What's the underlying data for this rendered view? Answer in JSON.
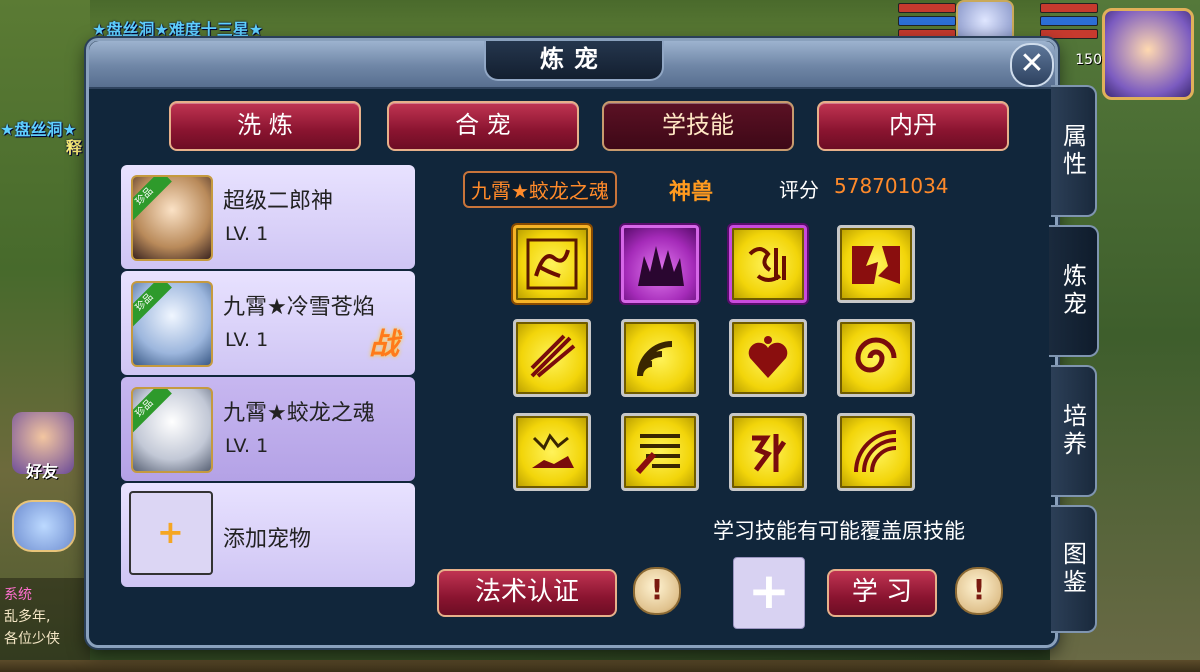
{
  "hud": {
    "banner_top": "★盘丝洞★难度十三星★",
    "banner_left": "★盘丝洞★",
    "banner_left2": "释",
    "level": "150",
    "friend_label": "好友",
    "chat_tag": "系统",
    "chat_lines": [
      "乱多年,",
      "各位少侠"
    ]
  },
  "dialog": {
    "title": "炼宠",
    "close_label": "✕"
  },
  "tabs": [
    {
      "label": "洗 炼",
      "active": false
    },
    {
      "label": "合 宠",
      "active": false
    },
    {
      "label": "学技能",
      "active": true
    },
    {
      "label": "内丹",
      "active": false
    }
  ],
  "pets": [
    {
      "badge": "珍品",
      "name": "超级二郎神",
      "level": "LV. 1",
      "battle": ""
    },
    {
      "badge": "珍品",
      "name": "九霄★冷雪苍焰",
      "level": "LV. 1",
      "battle": "战"
    },
    {
      "badge": "珍品",
      "name": "九霄★蛟龙之魂",
      "level": "LV. 1",
      "battle": ""
    }
  ],
  "add_pet_label": "添加宠物",
  "add_pet_icon": "+",
  "pet_info": {
    "name": "九霄★蛟龙之魂",
    "class": "神兽",
    "score_label": "评分",
    "score_value": "578701034"
  },
  "skills": [
    {
      "icon": "dragon-skill-icon",
      "frame": "gold"
    },
    {
      "icon": "spikes-skill-icon",
      "frame": "purple"
    },
    {
      "icon": "rune-skill-icon",
      "frame": "purple"
    },
    {
      "icon": "burst-skill-icon",
      "frame": "normal"
    },
    {
      "icon": "claw-skill-icon",
      "frame": "normal"
    },
    {
      "icon": "wave-skill-icon",
      "frame": "normal"
    },
    {
      "icon": "heart-skill-icon",
      "frame": "normal"
    },
    {
      "icon": "swirl-skill-icon",
      "frame": "normal"
    },
    {
      "icon": "beast-skill-icon",
      "frame": "normal"
    },
    {
      "icon": "scroll-skill-icon",
      "frame": "normal"
    },
    {
      "icon": "glyph-skill-icon",
      "frame": "normal"
    },
    {
      "icon": "arc-skill-icon",
      "frame": "normal"
    }
  ],
  "learn_hint": "学习技能有可能覆盖原技能",
  "buttons": {
    "certify": "法术认证",
    "learn": "学 习",
    "info": "!"
  },
  "learn_slot_icon": "+",
  "side_tabs": [
    {
      "label": "属性",
      "active": false
    },
    {
      "label": "炼宠",
      "active": true
    },
    {
      "label": "培养",
      "active": false
    },
    {
      "label": "图鉴",
      "active": false
    }
  ]
}
